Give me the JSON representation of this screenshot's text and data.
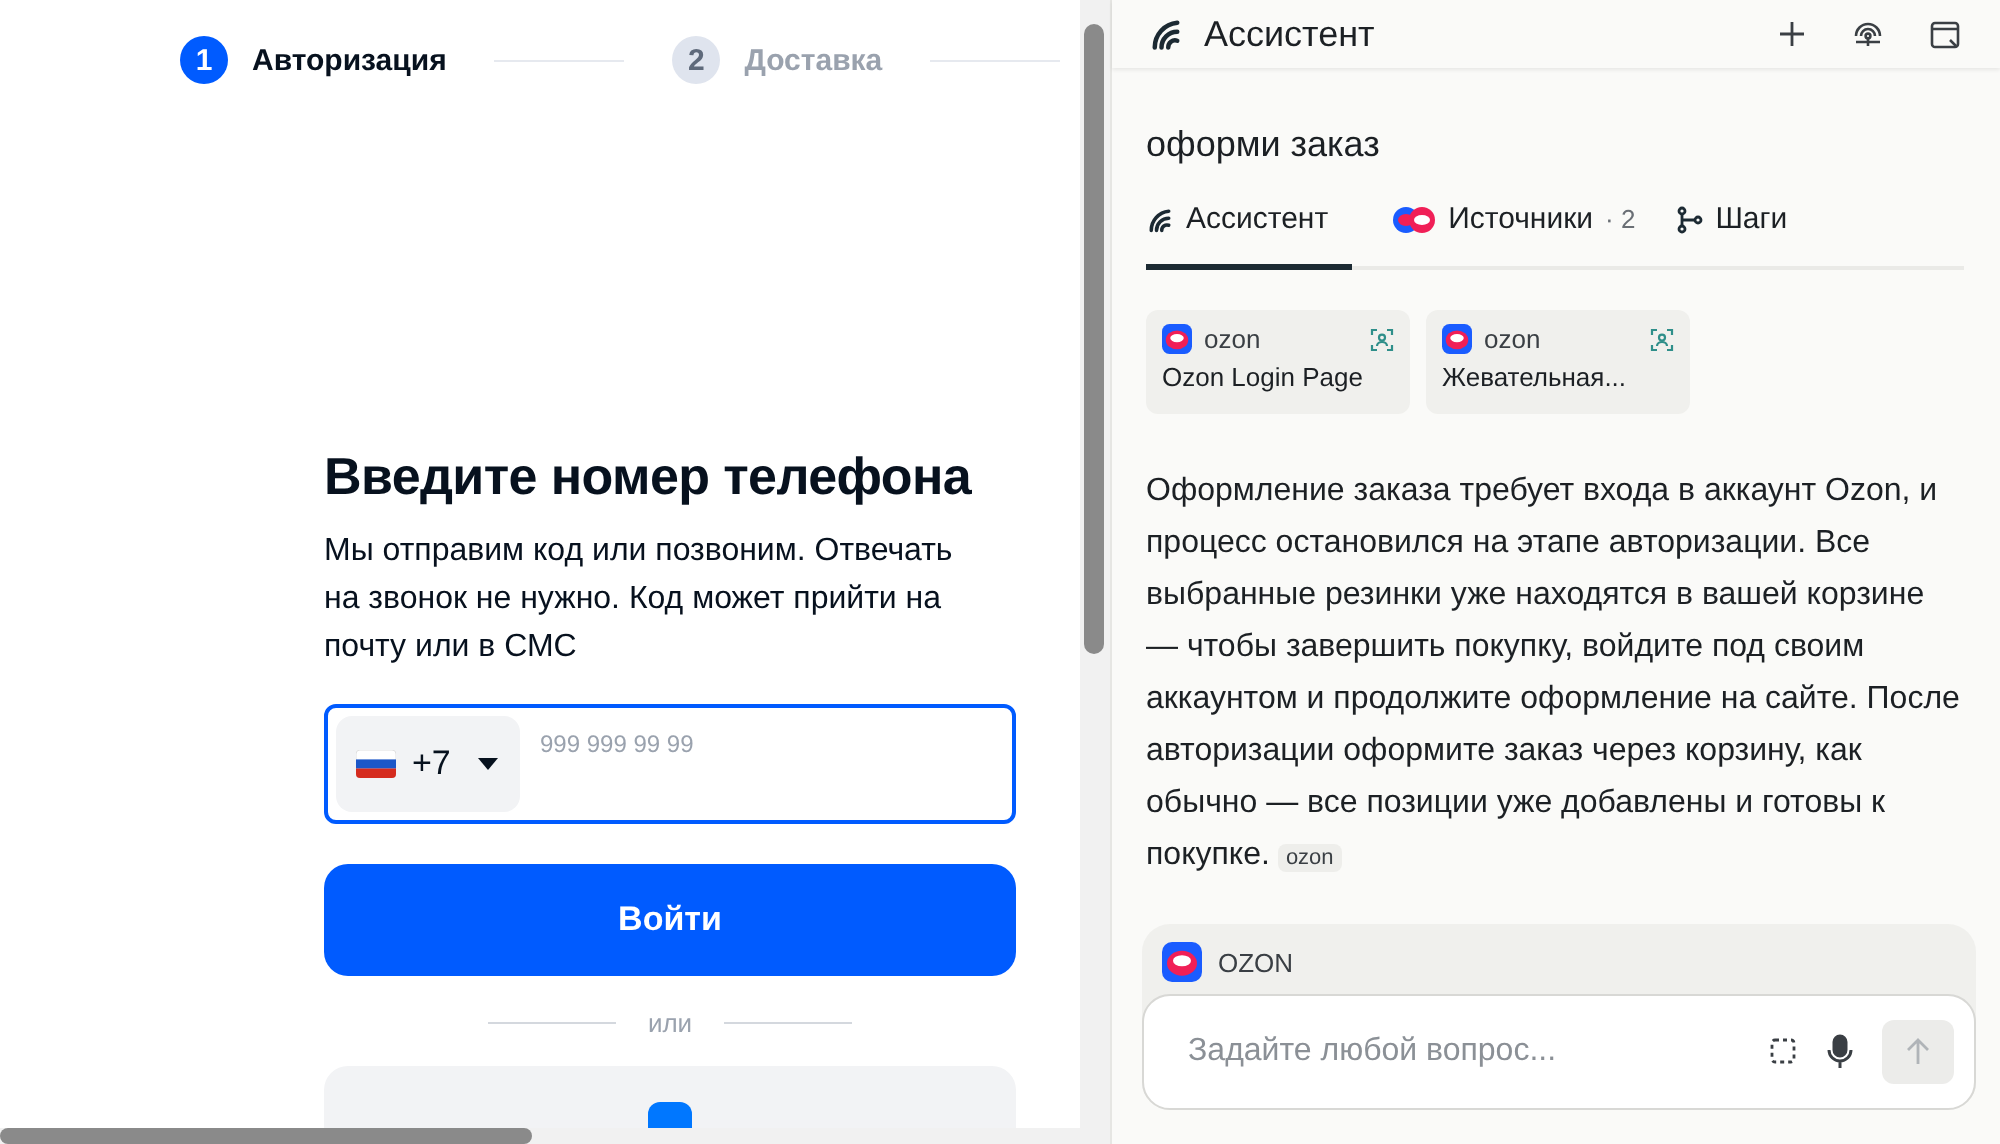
{
  "checkout": {
    "steps": [
      {
        "number": "1",
        "label": "Авторизация",
        "selected": true
      },
      {
        "number": "2",
        "label": "Доставка",
        "selected": false
      }
    ],
    "heading": "Введите номер телефона",
    "description": "Мы отправим код или позвоним. Отвечать на звонок не нужно. Код может прийти на почту или в СМС",
    "phone": {
      "country_code": "+7",
      "placeholder": "999 999 99 99"
    },
    "submit": "Войти",
    "divider": "или"
  },
  "assistant": {
    "title": "Ассистент",
    "query": "оформи заказ",
    "tabs": [
      {
        "kind": "assistant",
        "label": "Ассистент",
        "selected": true
      },
      {
        "kind": "sources",
        "label": "Источники",
        "count": "· 2",
        "selected": false
      },
      {
        "kind": "steps",
        "label": "Шаги",
        "selected": false
      }
    ],
    "sources": [
      {
        "site": "ozon",
        "title": "Ozon Login Page"
      },
      {
        "site": "ozon",
        "title": "Жевательная..."
      }
    ],
    "answer": "Оформление заказа требует входа в аккаунт Ozon, и процесс остановился на этапе авторизации. Все выбранные резинки уже находятся в вашей корзине — чтобы завершить покупку, войдите под своим аккаунтом и продолжите оформление на сайте. После авторизации оформите заказ через корзину, как обычно — все позиции уже добавлены и готовы к покупке.",
    "answer_tag": "ozon",
    "context": "OZON",
    "composer": {
      "placeholder": "Задайте любой вопрос..."
    }
  }
}
